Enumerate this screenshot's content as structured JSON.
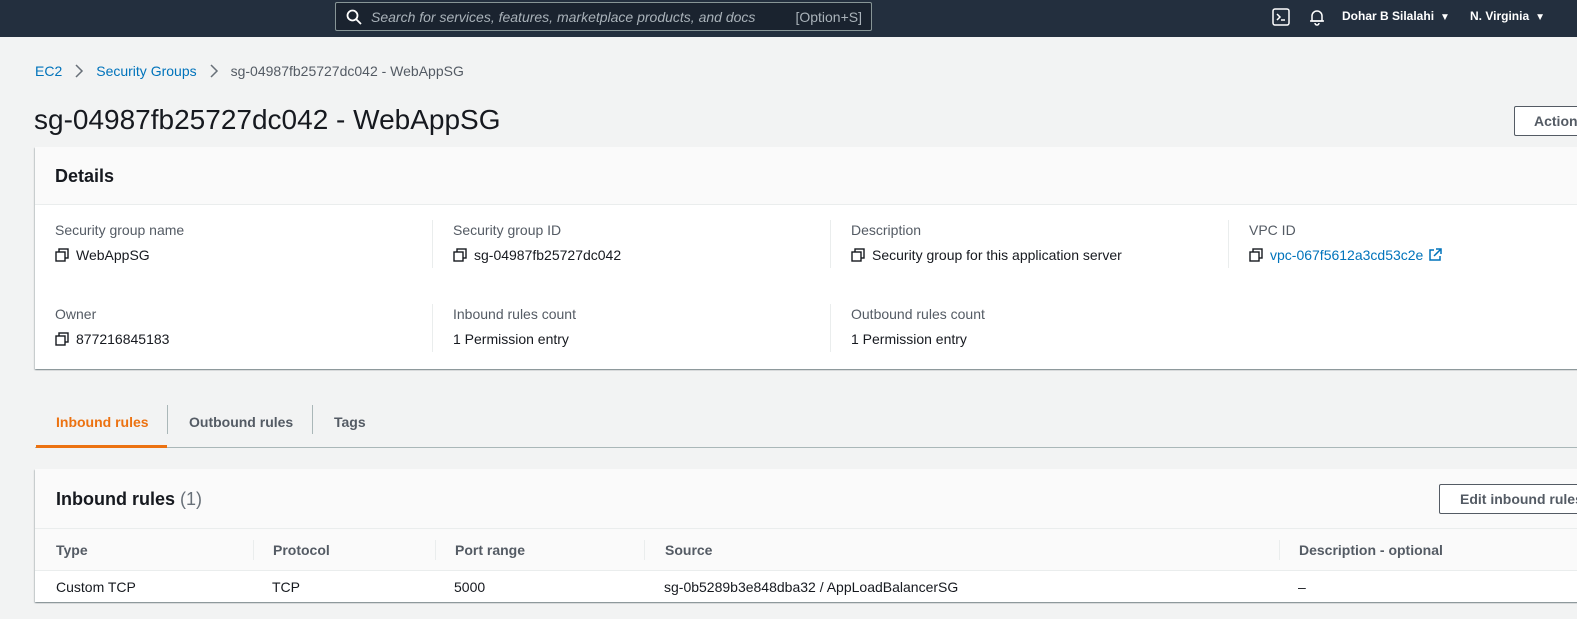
{
  "topnav": {
    "search_placeholder": "Search for services, features, marketplace products, and docs",
    "search_shortcut": "[Option+S]",
    "user": "Dohar B Silalahi",
    "region": "N. Virginia"
  },
  "breadcrumb": {
    "items": [
      "EC2",
      "Security Groups"
    ],
    "current": "sg-04987fb25727dc042 - WebAppSG"
  },
  "page": {
    "title": "sg-04987fb25727dc042 - WebAppSG",
    "actions_label": "Actions"
  },
  "details": {
    "heading": "Details",
    "fields": [
      {
        "label": "Security group name",
        "value": "WebAppSG"
      },
      {
        "label": "Security group ID",
        "value": "sg-04987fb25727dc042"
      },
      {
        "label": "Description",
        "value": "Security group for this application server"
      },
      {
        "label": "VPC ID",
        "value": "vpc-067f5612a3cd53c2e"
      },
      {
        "label": "Owner",
        "value": "877216845183"
      },
      {
        "label": "Inbound rules count",
        "value": "1 Permission entry"
      },
      {
        "label": "Outbound rules count",
        "value": "1 Permission entry"
      }
    ]
  },
  "tabs": [
    "Inbound rules",
    "Outbound rules",
    "Tags"
  ],
  "inbound": {
    "heading": "Inbound rules",
    "count": "(1)",
    "edit_label": "Edit inbound rules",
    "columns": [
      "Type",
      "Protocol",
      "Port range",
      "Source",
      "Description - optional"
    ],
    "rows": [
      [
        "Custom TCP",
        "TCP",
        "5000",
        "sg-0b5289b3e848dba32 / AppLoadBalancerSG",
        "–"
      ]
    ]
  },
  "colors": {
    "nav_bg": "#232f3e",
    "link": "#0073bb",
    "active_tab": "#ec7211"
  }
}
